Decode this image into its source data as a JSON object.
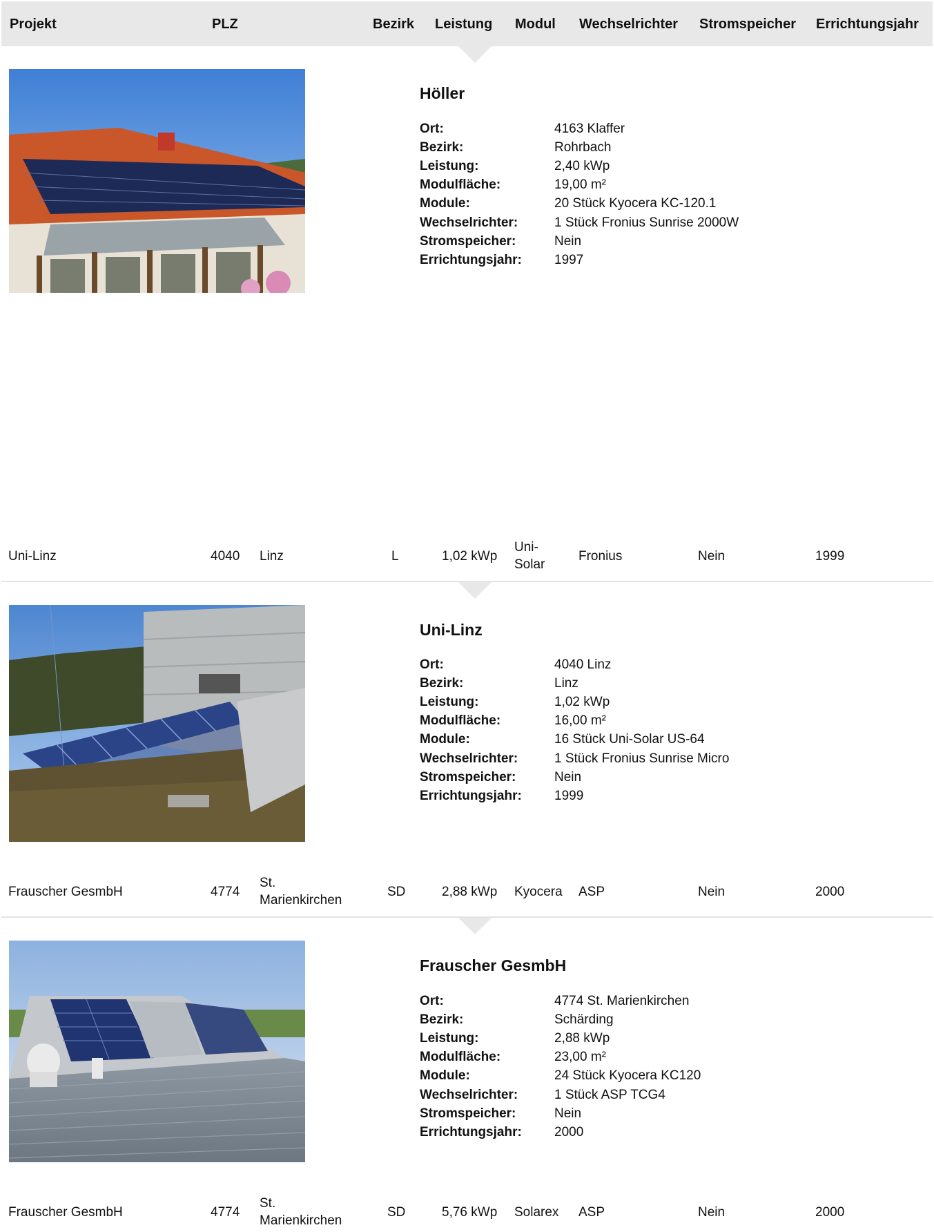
{
  "header": {
    "columns": [
      "Projekt",
      "PLZ",
      "Bezirk",
      "Leistung",
      "Modul",
      "Wechselrichter",
      "Stromspeicher",
      "Errichtungsjahr"
    ]
  },
  "details": [
    {
      "title": "Höller",
      "fields": [
        {
          "label": "Ort:",
          "value": "4163 Klaffer"
        },
        {
          "label": "Bezirk:",
          "value": "Rohrbach"
        },
        {
          "label": "Leistung:",
          "value": "2,40 kWp"
        },
        {
          "label": "Modulfläche:",
          "value": "19,00 m²"
        },
        {
          "label": "Module:",
          "value": "20 Stück Kyocera KC-120.1"
        },
        {
          "label": "Wechselrichter:",
          "value": "1 Stück Fronius Sunrise 2000W"
        },
        {
          "label": "Stromspeicher:",
          "value": "Nein"
        },
        {
          "label": "Errichtungsjahr:",
          "value": "1997"
        }
      ]
    },
    {
      "title": "Uni-Linz",
      "fields": [
        {
          "label": "Ort:",
          "value": "4040 Linz"
        },
        {
          "label": "Bezirk:",
          "value": "Linz"
        },
        {
          "label": "Leistung:",
          "value": "1,02 kWp"
        },
        {
          "label": "Modulfläche:",
          "value": "16,00 m²"
        },
        {
          "label": "Module:",
          "value": "16 Stück Uni-Solar US-64"
        },
        {
          "label": "Wechselrichter:",
          "value": "1 Stück Fronius Sunrise Micro"
        },
        {
          "label": "Stromspeicher:",
          "value": "Nein"
        },
        {
          "label": "Errichtungsjahr:",
          "value": "1999"
        }
      ]
    },
    {
      "title": "Frauscher GesmbH",
      "fields": [
        {
          "label": "Ort:",
          "value": "4774 St. Marienkirchen"
        },
        {
          "label": "Bezirk:",
          "value": "Schärding"
        },
        {
          "label": "Leistung:",
          "value": "2,88 kWp"
        },
        {
          "label": "Modulfläche:",
          "value": "23,00 m²"
        },
        {
          "label": "Module:",
          "value": "24 Stück Kyocera KC120"
        },
        {
          "label": "Wechselrichter:",
          "value": "1 Stück ASP TCG4"
        },
        {
          "label": "Stromspeicher:",
          "value": "Nein"
        },
        {
          "label": "Errichtungsjahr:",
          "value": "2000"
        }
      ]
    }
  ],
  "rows": [
    {
      "projekt": "Uni-Linz",
      "plz": "4040",
      "ort": "Linz",
      "ort_2": "",
      "bezirk": "L",
      "leistung": "1,02 kWp",
      "modul": "Uni-",
      "modul_2": "Solar",
      "wechselrichter": "Fronius",
      "stromspeicher": "Nein",
      "jahr": "1999"
    },
    {
      "projekt": "Frauscher GesmbH",
      "plz": "4774",
      "ort": "St.",
      "ort_2": "Marienkirchen",
      "bezirk": "SD",
      "leistung": "2,88 kWp",
      "modul": "Kyocera",
      "modul_2": "",
      "wechselrichter": "ASP",
      "stromspeicher": "Nein",
      "jahr": "2000"
    },
    {
      "projekt": "Frauscher GesmbH",
      "plz": "4774",
      "ort": "St.",
      "ort_2": "Marienkirchen",
      "bezirk": "SD",
      "leistung": "5,76 kWp",
      "modul": "Solarex",
      "modul_2": "",
      "wechselrichter": "ASP",
      "stromspeicher": "Nein",
      "jahr": "2000"
    }
  ]
}
